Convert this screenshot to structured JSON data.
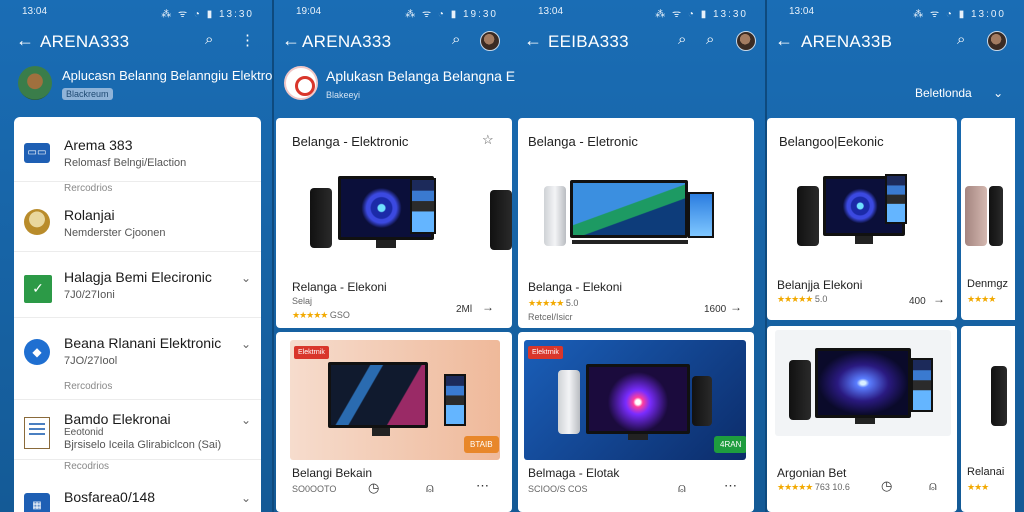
{
  "screens": [
    {
      "status": {
        "time": "13:04",
        "icons": "⁂ ᯤ ◔ ▮ 13:30"
      },
      "appbar": {
        "title": "ARENA333"
      },
      "header": {
        "title": "Aplucasn Belanng Belanngiu Elektronik",
        "chip": "Blackreum"
      },
      "list": [
        {
          "title": "Arema 383",
          "subtitle": "Relomasf Belngi/Elaction",
          "icon": "id-card-icon"
        },
        {
          "section": "Rercodrios"
        },
        {
          "title": "Rolanjai",
          "subtitle": "Nemderster Cjoonen",
          "icon": "avatar-icon"
        },
        {
          "title": "Halagja Bemi Elecironic",
          "subtitle": "7J0/27Ioni",
          "icon": "check-icon"
        },
        {
          "title": "Beana Rlanani Elektronic",
          "subtitle": "7JO/27Iool",
          "icon": "shield-icon"
        },
        {
          "section": "Rercodrios"
        },
        {
          "title": "Bamdo Elekronai",
          "subtitle": "Eeotonid",
          "subtitle2": "Bjrsiselo Iceila Glirabiclcon (Sai)",
          "icon": "document-icon"
        },
        {
          "section": "Recodrios"
        },
        {
          "title": "Bosfarea0/148",
          "icon": "app-icon"
        }
      ]
    },
    {
      "status": {
        "time": "19:04",
        "icons": "⁂ ᯤ ◔ ▮ 19:30"
      },
      "appbar": {
        "title": "ARENA333"
      },
      "header": {
        "title": "Aplukasn Belanga Belangna Elektronicn Terpercaia",
        "sub": "Blakeeyi"
      },
      "card1": {
        "title": "Belanga - Elektronic",
        "product": "Relanga - Elekoni",
        "rating": "★★★★★",
        "rating_text": "GSO",
        "reviews": "Selaj",
        "price": "2Ml"
      },
      "card2": {
        "badge": "Elektrnik",
        "badge2": "BTAIB",
        "product": "Belangi Bekain",
        "rating_text": "SO0OOTO"
      }
    },
    {
      "status": {
        "time": "13:04",
        "icons": "⁂ ᯤ ◔ ▮ 13:30"
      },
      "appbar": {
        "title": "EEIBA333"
      },
      "card1": {
        "title": "Belanga - Eletronic",
        "product": "Belanga - Elekoni",
        "rating": "★★★★★",
        "rating_text": "5.0",
        "reviews": "Retcel/Isicr",
        "price": "1600"
      },
      "card2": {
        "badge": "Elektrnik",
        "badge2": "4RAN",
        "product": "Belmaga - Elotak",
        "rating_text": "SCIOO/S COS"
      }
    },
    {
      "status": {
        "time": "13:04",
        "icons": "⁂ ᯤ ◔ ▮ 13:00"
      },
      "appbar": {
        "title": "ARENA33B"
      },
      "filter": "Beletlonda",
      "card1": {
        "title": "Belangoo|Eekonic",
        "product": "Belanjja Elekoni",
        "rating": "★★★★★",
        "rating_text": "5.0",
        "price": "400",
        "side_product": "Denmgz",
        "side_rating": "★★★★"
      },
      "card2": {
        "product": "Argonian Bet",
        "rating": "★★★★★",
        "rating_text": "763 10.6",
        "side_product": "Relanai",
        "side_rating": "★★★"
      }
    }
  ]
}
